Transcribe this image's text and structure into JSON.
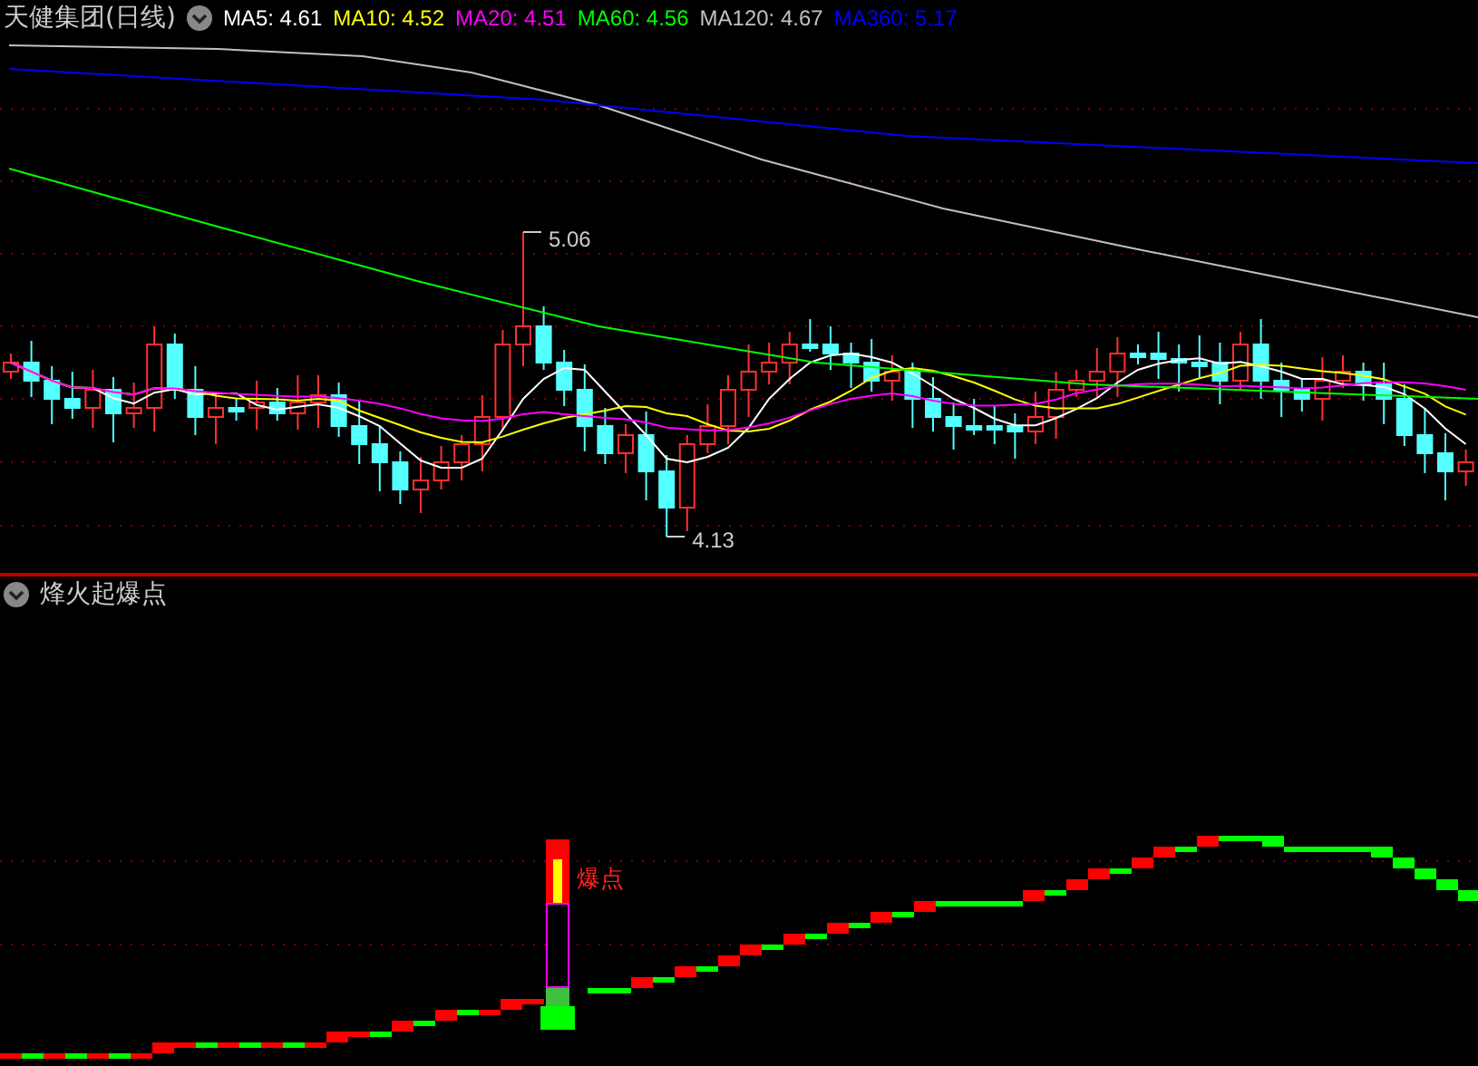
{
  "main_chart": {
    "title": "天健集团(日线)",
    "moving_averages": [
      {
        "label": "MA5: 4.61",
        "color": "#ffffff"
      },
      {
        "label": "MA10: 4.52",
        "color": "#ffff00"
      },
      {
        "label": "MA20: 4.51",
        "color": "#ff00ff"
      },
      {
        "label": "MA60: 4.56",
        "color": "#00ff00"
      },
      {
        "label": "MA120: 4.67",
        "color": "#c0c0c0"
      },
      {
        "label": "MA360: 5.17",
        "color": "#0000ff"
      }
    ],
    "high_label": "5.06",
    "low_label": "4.13"
  },
  "indicator": {
    "title": "烽火起爆点",
    "signal_label": "爆点"
  }
}
